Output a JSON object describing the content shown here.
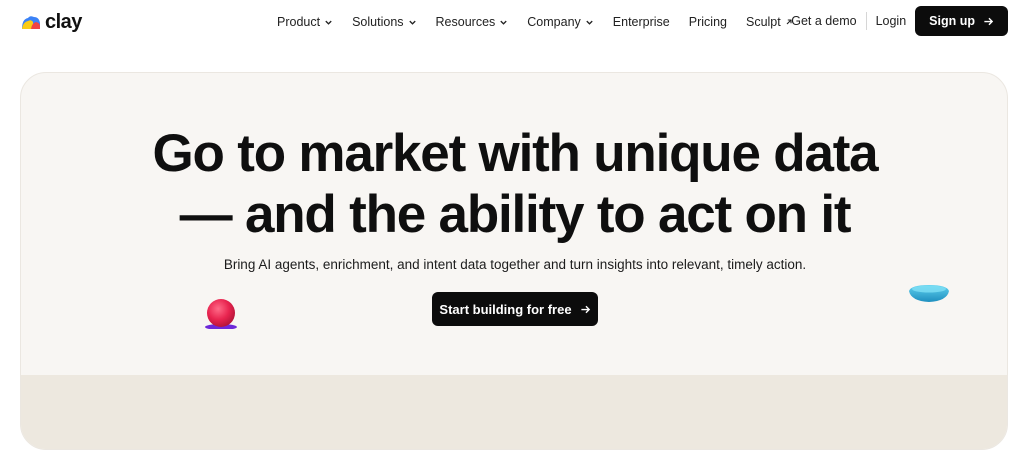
{
  "brand": {
    "name": "clay"
  },
  "nav": {
    "items": [
      {
        "label": "Product",
        "has_dropdown": true
      },
      {
        "label": "Solutions",
        "has_dropdown": true
      },
      {
        "label": "Resources",
        "has_dropdown": true
      },
      {
        "label": "Company",
        "has_dropdown": true
      },
      {
        "label": "Enterprise",
        "has_dropdown": false
      },
      {
        "label": "Pricing",
        "has_dropdown": false
      },
      {
        "label": "Sculpt",
        "has_dropdown": false,
        "external": true
      }
    ],
    "get_demo": "Get a demo",
    "login": "Login",
    "signup": "Sign up"
  },
  "hero": {
    "headline_line1": "Go to market with unique data",
    "headline_line2": "— and the ability to act on it",
    "subheadline": "Bring AI agents, enrichment, and intent data together and turn insights into relevant, timely action.",
    "cta": "Start building for free"
  },
  "icons": {
    "logo": "clay-logo-icon",
    "dropdown": "chevron-down-icon",
    "external": "arrow-up-right-icon",
    "arrow": "arrow-right-icon"
  },
  "colors": {
    "button_bg": "#0c0c0c",
    "hero_bg": "#f8f6f3",
    "hero_bottom_bg": "#ede8df",
    "blob_pink": "#f0325a",
    "blob_cyan": "#35b6db"
  }
}
